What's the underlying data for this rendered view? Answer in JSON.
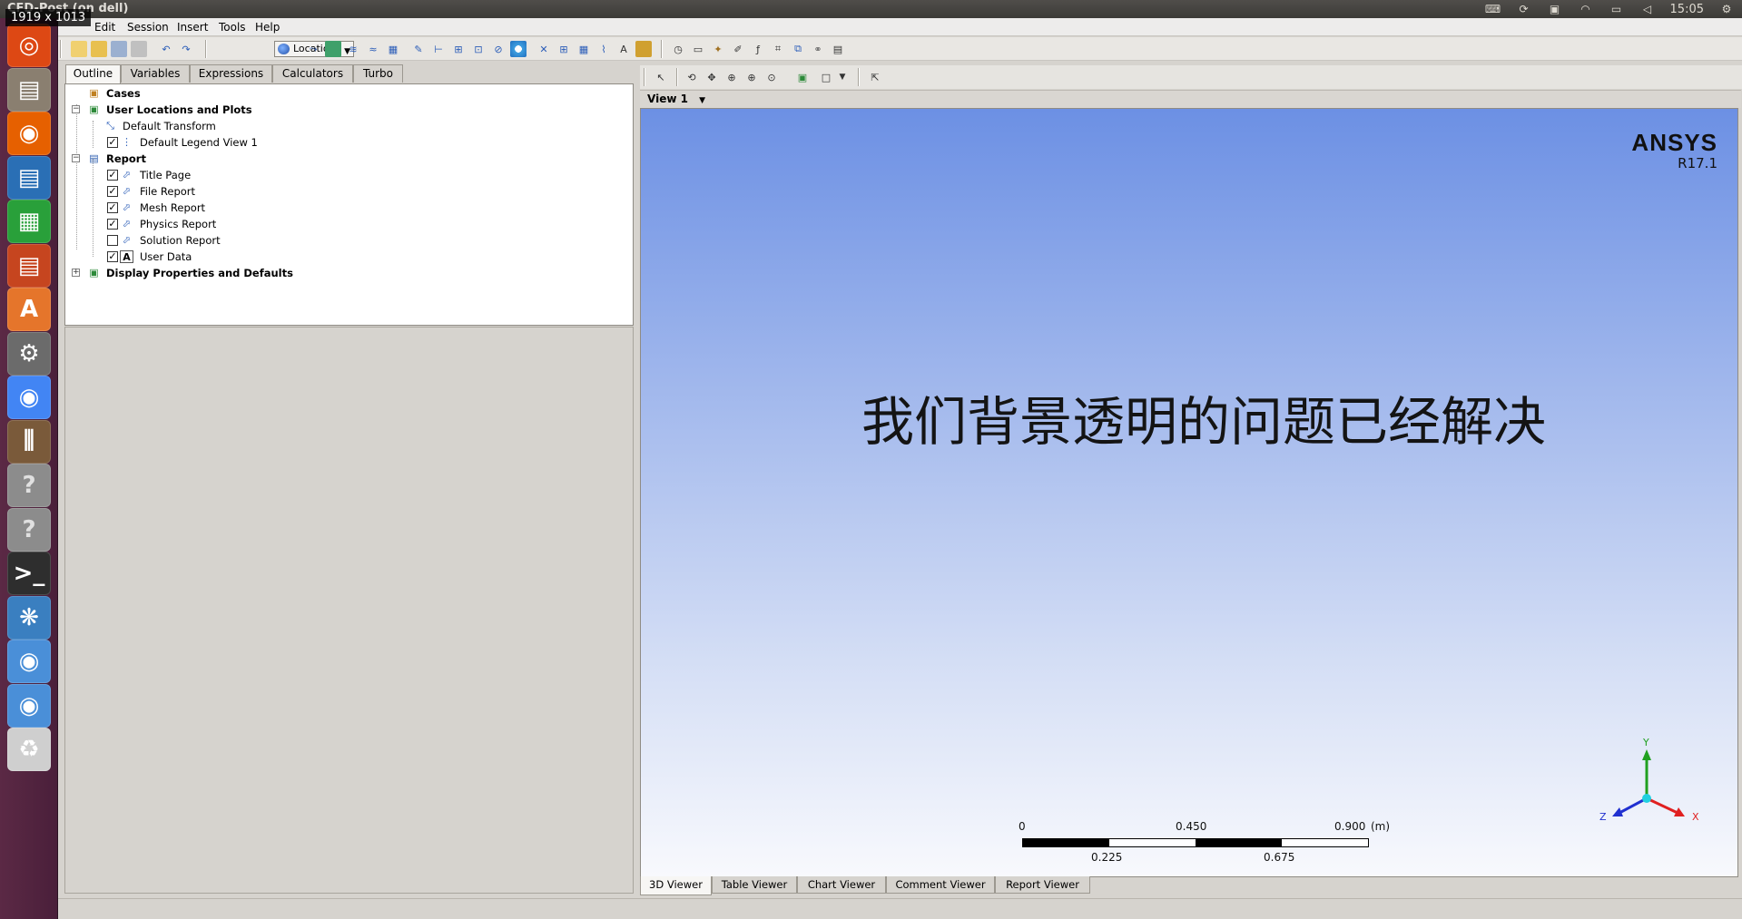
{
  "window": {
    "title": "CFD-Post (on dell)",
    "dimension_badge": "1919 x 1013"
  },
  "system_tray": {
    "clock": "15:05"
  },
  "launcher": [
    {
      "name": "ubuntu-dash-icon",
      "color": "#dd4814"
    },
    {
      "name": "files-icon",
      "color": "#8a7f70"
    },
    {
      "name": "firefox-icon",
      "color": "#e66000"
    },
    {
      "name": "writer-icon",
      "color": "#2a6fb5"
    },
    {
      "name": "calc-icon",
      "color": "#29a03a"
    },
    {
      "name": "impress-icon",
      "color": "#c6451f"
    },
    {
      "name": "software-center-icon",
      "color": "#e5752b"
    },
    {
      "name": "system-settings-icon",
      "color": "#6b6b6b"
    },
    {
      "name": "chrome-icon",
      "color": "#4285f4"
    },
    {
      "name": "mixer-icon",
      "color": "#7a5a3a"
    },
    {
      "name": "unknown-app-icon-1",
      "color": "#8c8c8c"
    },
    {
      "name": "unknown-app-icon-2",
      "color": "#8c8c8c"
    },
    {
      "name": "terminal-icon",
      "color": "#2e2e2e"
    },
    {
      "name": "cfd-post-icon",
      "color": "#3a7fc0"
    },
    {
      "name": "viewer-app-icon-1",
      "color": "#4a8fd8"
    },
    {
      "name": "viewer-app-icon-2",
      "color": "#4a8fd8"
    },
    {
      "name": "trash-icon",
      "color": "#cfcfcf"
    }
  ],
  "menu": {
    "edit": "Edit",
    "session": "Session",
    "insert": "Insert",
    "tools": "Tools",
    "help": "Help"
  },
  "toolbar": {
    "location_label": "Location"
  },
  "left_tabs": [
    "Outline",
    "Variables",
    "Expressions",
    "Calculators",
    "Turbo"
  ],
  "tree": {
    "cases": "Cases",
    "user_locations": "User Locations and Plots",
    "default_transform": "Default Transform",
    "default_legend": "Default Legend View 1",
    "report": "Report",
    "title_page": "Title Page",
    "file_report": "File Report",
    "mesh_report": "Mesh Report",
    "physics_report": "Physics Report",
    "solution_report": "Solution Report",
    "user_data": "User Data",
    "display_props": "Display Properties and Defaults",
    "checked": {
      "default_legend": true,
      "title_page": true,
      "file_report": true,
      "mesh_report": true,
      "physics_report": true,
      "solution_report": false,
      "user_data": true
    }
  },
  "viewer": {
    "view_name": "View 1",
    "logo_brand": "ANSYS",
    "logo_version": "R17.1",
    "message": "我们背景透明的问题已经解决",
    "scale": {
      "top_labels": [
        "0",
        "0.450",
        "0.900"
      ],
      "unit": "(m)",
      "bottom_labels": [
        "0.225",
        "0.675"
      ]
    },
    "axes": {
      "x": "X",
      "y": "Y",
      "z": "Z"
    }
  },
  "viewer_tabs": [
    "3D Viewer",
    "Table Viewer",
    "Chart Viewer",
    "Comment Viewer",
    "Report Viewer"
  ],
  "colors": {
    "background_top": "#6c90e4",
    "background_bottom": "#f8f9fd",
    "launcher": "#5b2945",
    "axis_x": "#e02020",
    "axis_y": "#20a020",
    "axis_z": "#2030d0"
  }
}
